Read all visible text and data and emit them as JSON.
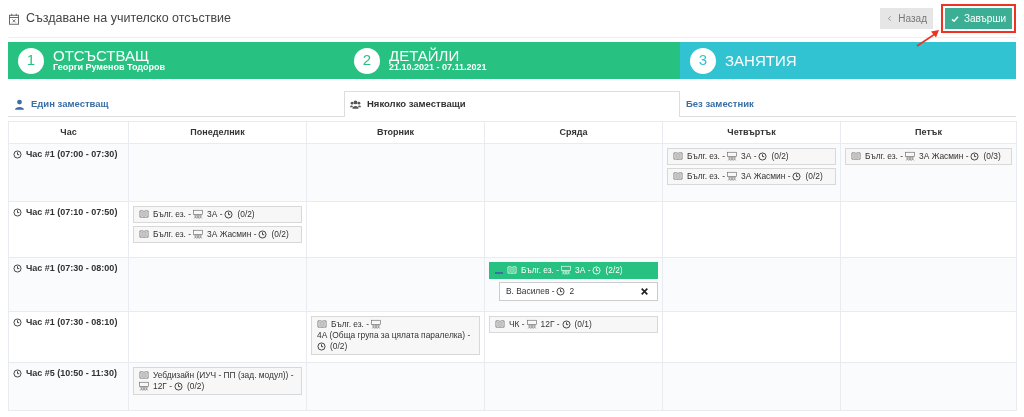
{
  "window": {
    "title": "Създаване на учителско отсъствие"
  },
  "buttons": [
    {
      "kind": "back",
      "label": "Назад",
      "highlighted": false
    },
    {
      "kind": "finish",
      "label": "Завърши",
      "highlighted": true
    }
  ],
  "steps": [
    {
      "number": "1",
      "title": "ОТСЪСТВАЩ",
      "subtitle": "Георги Руменов Тодоров",
      "done": true
    },
    {
      "number": "2",
      "title": "ДЕТАЙЛИ",
      "subtitle": "21.10.2021 - 07.11.2021",
      "done": true
    },
    {
      "number": "3",
      "title": "ЗАНЯТИЯ",
      "done": false
    }
  ],
  "tabs": [
    {
      "kind": "single",
      "label": "Един заместващ",
      "selected": false
    },
    {
      "kind": "multiple",
      "label": "Няколко заместващи",
      "selected": true
    },
    {
      "kind": "none",
      "label": "Без заместник",
      "selected": false
    }
  ],
  "table": {
    "columns": [
      "Час",
      "Понеделник",
      "Вторник",
      "Сряда",
      "Четвъртък",
      "Петък"
    ],
    "rows": [
      {
        "time": "Час #1 (07:00 - 07:30)",
        "thursday": [
          {
            "subject": "Бълг. ез. -",
            "group": "3А -",
            "count": "(0/2)",
            "expanded": false
          },
          {
            "subject": "Бълг. ез. -",
            "group": "3А Жасмин -",
            "count": "(0/2)",
            "expanded": false
          }
        ],
        "friday": [
          {
            "subject": "Бълг. ез. -",
            "group": "3А Жасмин -",
            "count": "(0/3)",
            "expanded": false
          }
        ]
      },
      {
        "time": "Час #1 (07:10 - 07:50)",
        "monday": [
          {
            "subject": "Бълг. ез. -",
            "group": "3А -",
            "count": "(0/2)",
            "expanded": false
          },
          {
            "subject": "Бълг. ез. -",
            "group": "3А Жасмин -",
            "count": "(0/2)",
            "expanded": false
          }
        ]
      },
      {
        "time": "Час #1 (07:30 - 08:00)",
        "wednesday": [
          {
            "subject": "Бълг. ез. -",
            "group": "3А -",
            "count": "(2/2)",
            "expanded": true,
            "substitutes": [
              {
                "name": "В. Василев -",
                "hours": "2"
              }
            ]
          }
        ]
      },
      {
        "time": "Час #1 (07:30 - 08:10)",
        "tuesday": [
          {
            "subject": "Бълг. ез. -",
            "group": "4А (Обща група за цялата паралелка) -",
            "count": "(0/2)",
            "expanded": false
          }
        ],
        "wednesday": [
          {
            "subject": "ЧК -",
            "group": "12Г -",
            "count": "(0/1)",
            "expanded": false
          }
        ]
      },
      {
        "time": "Час #5 (10:50 - 11:30)",
        "monday": [
          {
            "subject": "Уебдизайн (ИУЧ - ПП (зад. модул)) -",
            "group": "12Г -",
            "count": "(0/2)",
            "expanded": false
          }
        ]
      }
    ]
  }
}
